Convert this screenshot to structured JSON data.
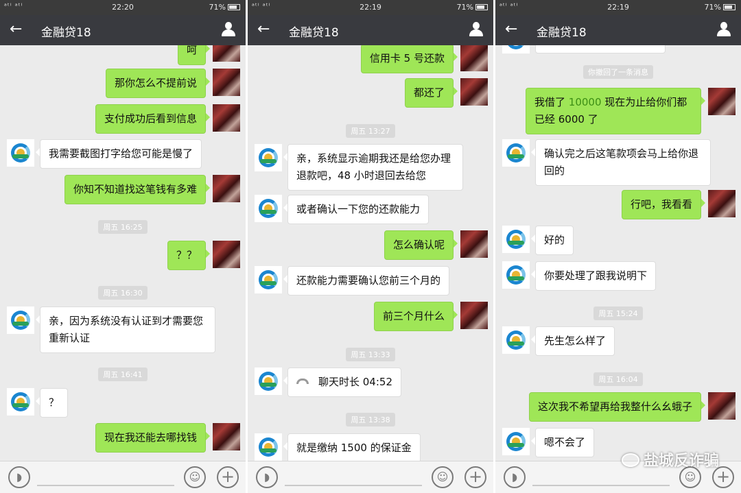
{
  "panels": [
    {
      "status": {
        "signal": "ᵃᵗˡ ᵃᵗˡ",
        "time": "22:20",
        "battery": "71%"
      },
      "title": "金融贷18",
      "stamps": [
        "周五 16:25",
        "周五 16:30",
        "周五 16:41"
      ],
      "messages": [
        {
          "text": "呵"
        },
        {
          "text": "那你怎么不提前说"
        },
        {
          "text": "支付成功后看到信息"
        },
        {
          "text": "我需要截图打字给您可能是慢了"
        },
        {
          "text": "你知不知道找这笔钱有多难"
        },
        {
          "text": "？？"
        },
        {
          "text": "亲，因为系统没有认证到才需要您重新认证"
        },
        {
          "text": "？"
        },
        {
          "text": "现在我还能去哪找钱"
        }
      ]
    },
    {
      "status": {
        "signal": "ᵃᵗˡ ᵃᵗˡ",
        "time": "22:19",
        "battery": "71%"
      },
      "title": "金融贷18",
      "stamps": [
        "周五 13:27",
        "周五 13:33",
        "周五 13:38"
      ],
      "messages": [
        {
          "text": "信用卡 5 号还款"
        },
        {
          "text": "都还了"
        },
        {
          "text": "亲，系统显示逾期我还是给您办理退款吧，48 小时退回去给您"
        },
        {
          "text": "或者确认一下您的还款能力"
        },
        {
          "text": "怎么确认呢"
        },
        {
          "text": "还款能力需要确认您前三个月的"
        },
        {
          "text": "前三个月什么"
        },
        {
          "text": "聊天时长 04:52"
        },
        {
          "text": "就是缴纳 1500 的保证金"
        }
      ]
    },
    {
      "status": {
        "signal": "ᵃᵗˡ ᵃᵗˡ",
        "time": "22:19",
        "battery": "71%"
      },
      "title": "金融贷18",
      "recall_notice": "你撤回了一条消息",
      "stamps": [
        "周五 15:24",
        "周五 16:04"
      ],
      "messages": [
        {
          "text_a": "我借了",
          "amount": "10000",
          "text_b": "现在为止给你们都已经 6000 了"
        },
        {
          "text": "确认完之后这笔款项会马上给你退回的"
        },
        {
          "text": "行吧，我看看"
        },
        {
          "text": "好的"
        },
        {
          "text": "你要处理了跟我说明下"
        },
        {
          "text": "先生怎么样了"
        },
        {
          "text": "这次我不希望再给我整什么幺蛾子"
        },
        {
          "text": "嗯不会了"
        }
      ]
    }
  ],
  "watermark": "盐城反诈骗",
  "icons": {
    "back": "back-arrow-icon",
    "profile": "person-icon",
    "voice": "voice-input-icon",
    "emoji": "emoji-icon",
    "more": "plus-icon",
    "call": "phone-call-icon"
  },
  "colors": {
    "nav_bg": "#393a3f",
    "chat_bg": "#ebebeb",
    "my_bubble": "#9fe657",
    "their_bubble": "#ffffff"
  }
}
